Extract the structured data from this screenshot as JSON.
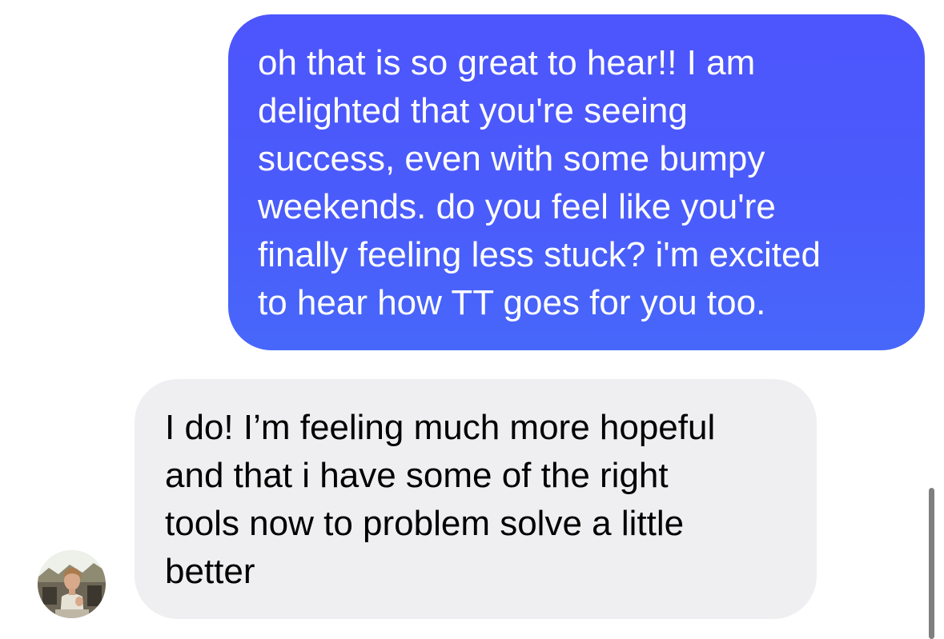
{
  "conversation": {
    "messages": [
      {
        "direction": "sent",
        "text": "oh that is so great to hear!! I am\ndelighted that you're seeing\nsuccess, even with some bumpy\nweekends. do you feel like you're\nfinally feeling less stuck? i'm excited\nto hear how TT goes for you too."
      },
      {
        "direction": "received",
        "text": "I do! I’m feeling much more hopeful\nand that i have some of the right\ntools now to problem solve a little\nbetter"
      }
    ],
    "contact": {
      "avatar_icon": "user-photo-avatar"
    }
  },
  "colors": {
    "sent_bubble": "#4b5efb",
    "received_bubble": "#efeff1",
    "sent_text": "#ffffff",
    "received_text": "#000000",
    "scrollbar": "#7f7f7f"
  }
}
